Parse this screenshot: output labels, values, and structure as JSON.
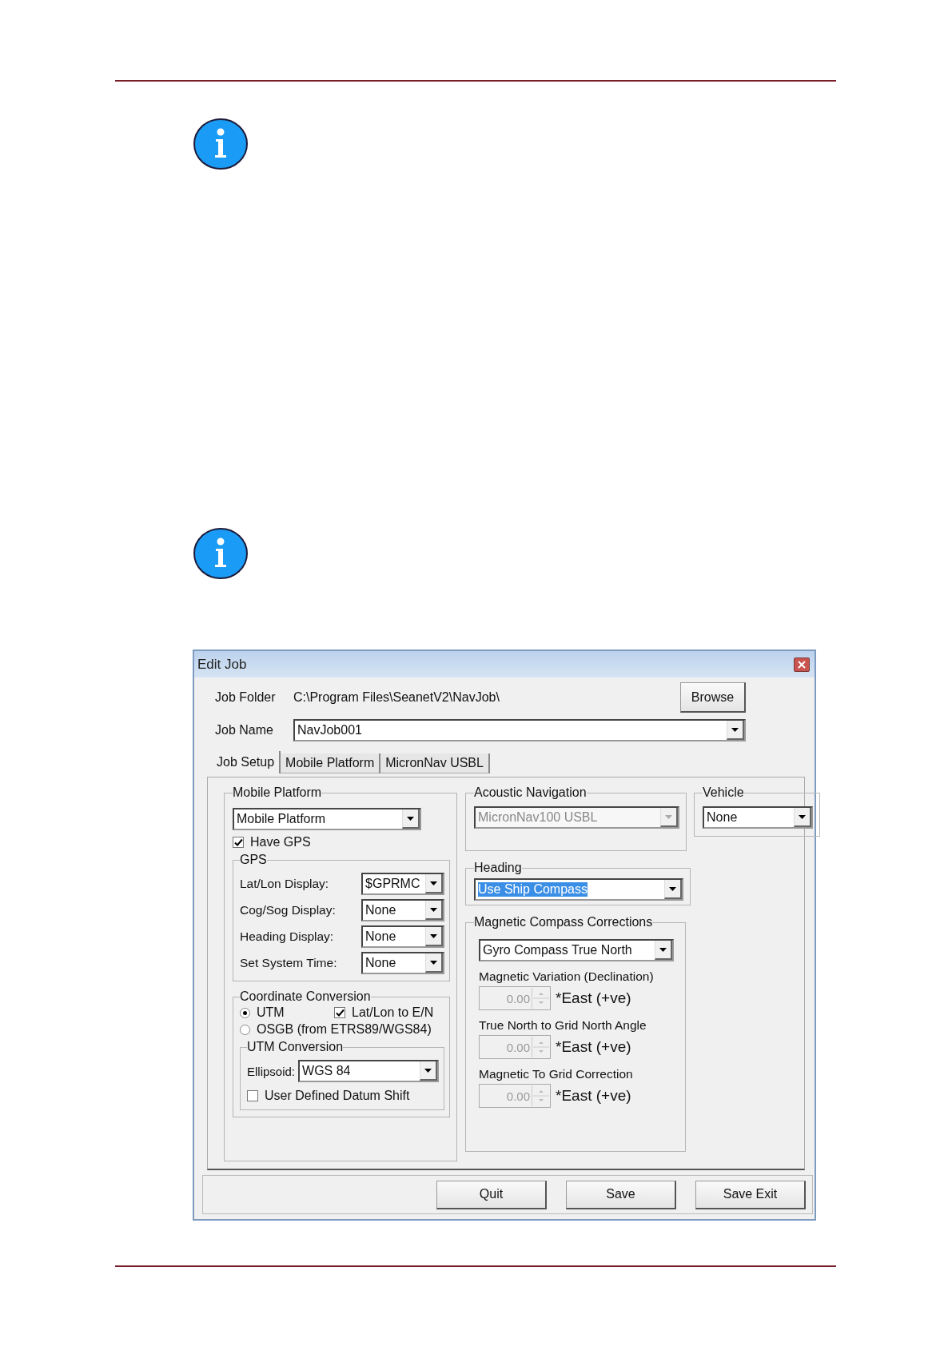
{
  "window": {
    "title": "Edit Job"
  },
  "job_folder": {
    "label": "Job Folder",
    "value": "C:\\Program Files\\SeanetV2\\NavJob\\"
  },
  "browse_button": "Browse",
  "job_name": {
    "label": "Job Name",
    "value": "NavJob001"
  },
  "tabs": [
    {
      "label": "Job Setup",
      "selected": true
    },
    {
      "label": "Mobile Platform",
      "selected": false
    },
    {
      "label": "MicronNav USBL",
      "selected": false
    }
  ],
  "mobile_platform": {
    "title": "Mobile Platform",
    "value": "Mobile Platform",
    "have_gps": {
      "label": "Have GPS",
      "checked": true
    },
    "gps": {
      "title": "GPS",
      "rows": [
        {
          "label": "Lat/Lon Display:",
          "value": "$GPRMC"
        },
        {
          "label": "Cog/Sog Display:",
          "value": "None"
        },
        {
          "label": "Heading Display:",
          "value": "None"
        },
        {
          "label": "Set System Time:",
          "value": "None"
        }
      ]
    },
    "coordinate_conversion": {
      "title": "Coordinate Conversion",
      "options": [
        {
          "label": "UTM",
          "selected": true
        },
        {
          "label": "OSGB (from ETRS89/WGS84)",
          "selected": false
        }
      ],
      "latlon_to_en": {
        "label": "Lat/Lon to E/N",
        "checked": true
      },
      "utm_conversion": {
        "title": "UTM Conversion",
        "ellipsoid": {
          "label": "Ellipsoid:",
          "value": "WGS 84"
        },
        "datum_shift": {
          "label": "User Defined Datum Shift",
          "checked": false
        }
      }
    }
  },
  "acoustic_navigation": {
    "title": "Acoustic Navigation",
    "value": "MicronNav100 USBL",
    "disabled": true
  },
  "vehicle": {
    "title": "Vehicle",
    "value": "None"
  },
  "heading": {
    "title": "Heading",
    "value": "Use Ship Compass",
    "highlighted": true
  },
  "magnetic_compass_corrections": {
    "title": "Magnetic Compass Corrections",
    "value": "Gyro Compass True North",
    "fields": [
      {
        "label": "Magnetic Variation (Declination)",
        "value": "0.00",
        "unit": "*East (+ve)",
        "disabled": true
      },
      {
        "label": "True North to Grid North Angle",
        "value": "0.00",
        "unit": "*East (+ve)",
        "disabled": true
      },
      {
        "label": "Magnetic To Grid Correction",
        "value": "0.00",
        "unit": "*East (+ve)",
        "disabled": true
      }
    ]
  },
  "buttons": [
    "Quit",
    "Save",
    "Save Exit"
  ]
}
